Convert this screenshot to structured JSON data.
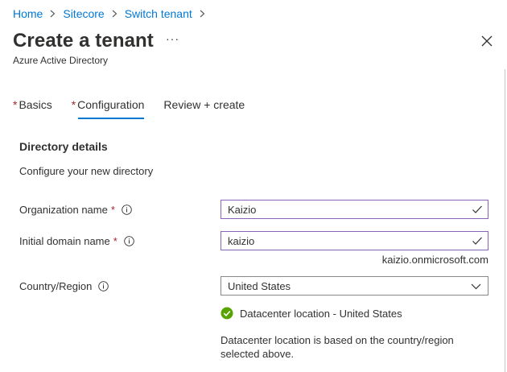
{
  "breadcrumb": {
    "items": [
      "Home",
      "Sitecore",
      "Switch tenant"
    ]
  },
  "header": {
    "title": "Create a tenant",
    "more": "···",
    "subtitle": "Azure Active Directory"
  },
  "tabs": [
    {
      "label": "Basics",
      "required_mark": "*"
    },
    {
      "label": "Configuration",
      "required_mark": "*"
    },
    {
      "label": "Review + create",
      "required_mark": ""
    }
  ],
  "section": {
    "title": "Directory details",
    "description": "Configure your new directory"
  },
  "form": {
    "org_name": {
      "label": "Organization name",
      "required_mark": "*",
      "value": "Kaizio"
    },
    "domain_name": {
      "label": "Initial domain name",
      "required_mark": "*",
      "value": "kaizio",
      "suffix": "kaizio.onmicrosoft.com"
    },
    "country": {
      "label": "Country/Region",
      "value": "United States"
    }
  },
  "datacenter": {
    "status": "Datacenter location - United States",
    "note": "Datacenter location is based on the country/region selected above."
  },
  "colors": {
    "accent": "#0078d4",
    "required": "#a4262c",
    "valid_border": "#8764b8",
    "success": "#57a300"
  }
}
